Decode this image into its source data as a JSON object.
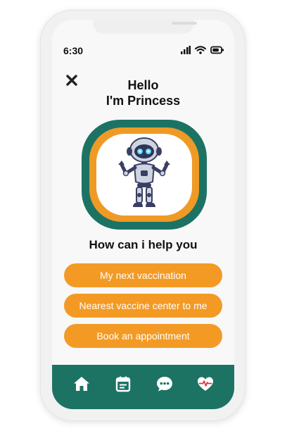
{
  "status_bar": {
    "time": "6:30",
    "icons": [
      "signal-icon",
      "wifi-icon",
      "battery-icon"
    ]
  },
  "header": {
    "close_icon": "close-icon",
    "greeting_line1": "Hello",
    "greeting_line2": "I'm Princess"
  },
  "assistant": {
    "avatar_icon": "robot-icon",
    "question": "How can i help you"
  },
  "options": [
    {
      "label": "My next vaccination"
    },
    {
      "label": "Nearest vaccine center to me"
    },
    {
      "label": "Book an appointment"
    }
  ],
  "tabbar": {
    "items": [
      "home-icon",
      "calendar-icon",
      "chat-icon",
      "health-icon"
    ]
  },
  "colors": {
    "accent_orange": "#f39a24",
    "accent_teal": "#1c7364",
    "background": "#f8f8f8",
    "text": "#111111"
  }
}
